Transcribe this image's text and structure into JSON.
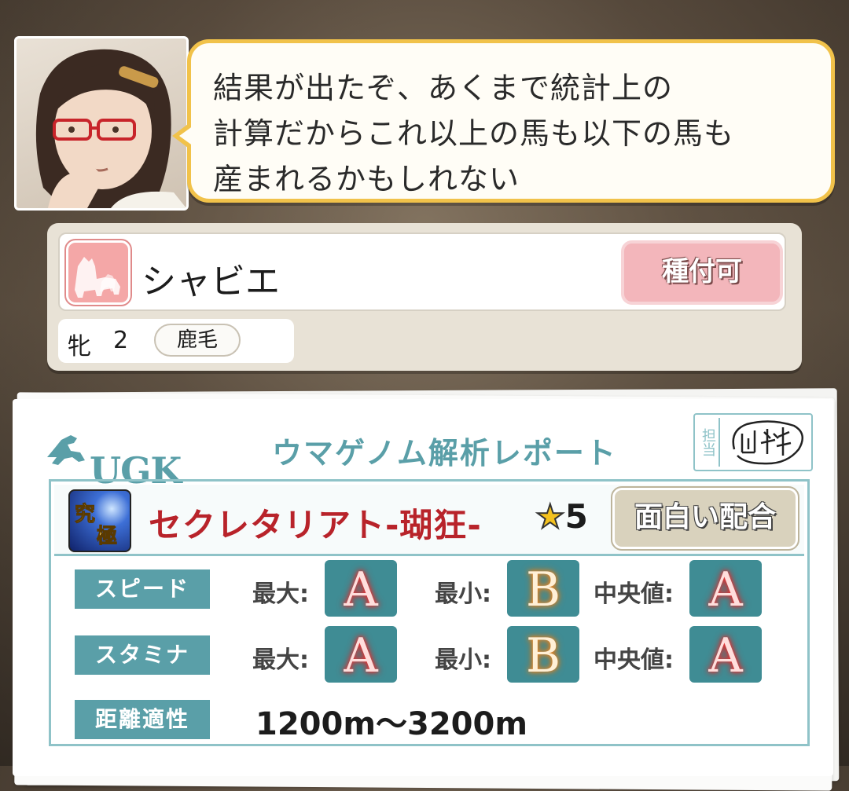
{
  "dialogue": {
    "lines": [
      "結果が出たぞ、あくまで統計上の",
      "計算だからこれ以上の馬も以下の馬も",
      "産まれるかもしれない"
    ]
  },
  "horse": {
    "name": "シャビエ",
    "sex": "牝",
    "age": "2",
    "coat": "鹿毛",
    "breed_button": "種付可"
  },
  "report": {
    "logo": "UGK",
    "title": "ウマゲノム解析レポート",
    "stamp_label": "担当",
    "sire": {
      "name": "セクレタリアト-瑚狂-",
      "star_symbol": "★",
      "stars": "5",
      "match_badge": "面白い配合"
    },
    "stats": [
      {
        "label": "スピード",
        "max_label": "最大:",
        "max": "A",
        "min_label": "最小:",
        "min": "B",
        "median_label": "中央値:",
        "median": "A"
      },
      {
        "label": "スタミナ",
        "max_label": "最大:",
        "max": "A",
        "min_label": "最小:",
        "min": "B",
        "median_label": "中央値:",
        "median": "A"
      }
    ],
    "distance": {
      "label": "距離適性",
      "value": "1200m〜3200m"
    }
  },
  "colors": {
    "accent_teal": "#5a9fa8",
    "grade_bg": "#3f8c94",
    "bubble_border": "#f1c24a",
    "sire_red": "#b8232a",
    "breed_pink": "#f3b6bb"
  }
}
